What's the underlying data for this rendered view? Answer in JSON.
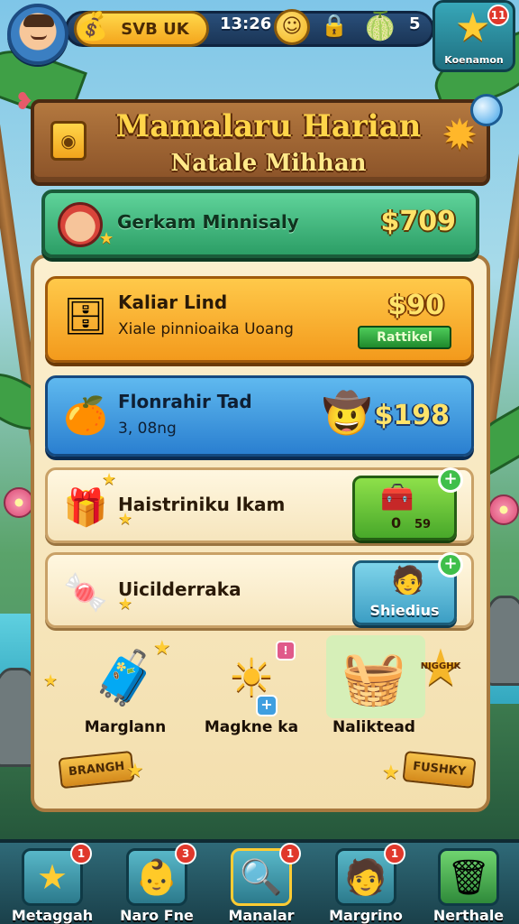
{
  "topbar": {
    "currency_label": "SVB UK",
    "time": "13:26",
    "count": "5",
    "corner_label": "Koenamon",
    "corner_badge": "11"
  },
  "panel": {
    "title": "Mamalaru Harian",
    "subtitle": "Natale Mihhan",
    "featured": {
      "name": "Gerkam Minnisaly",
      "price": "$709"
    },
    "rows": [
      {
        "title": "Kaliar Lind",
        "subtitle": "Xiale pinnioaika Uoang",
        "price": "$90",
        "ribbon": "Rattikel"
      },
      {
        "title": "Flonrahir Tad",
        "subtitle": "3, 08ng",
        "price": "$198"
      },
      {
        "title": "Haistriniku lkam",
        "button_number": "0",
        "button_extra": "59"
      },
      {
        "title": "Uicilderraka",
        "button_label": "Shiedius"
      }
    ],
    "grid": [
      {
        "label": "Marglann"
      },
      {
        "label": "Magkne ka"
      },
      {
        "label": "Naliktead"
      }
    ],
    "stickers": {
      "left": "BRANGH",
      "right": "FUSHKY",
      "star_badge": "NIGGHK"
    }
  },
  "bottom_nav": [
    {
      "label": "Metaggah",
      "badge": "1"
    },
    {
      "label": "Naro Fne",
      "badge": "3"
    },
    {
      "label": "Manalar",
      "badge": "1"
    },
    {
      "label": "Margrino",
      "badge": "1"
    },
    {
      "label": "Nerthale",
      "badge": ""
    }
  ]
}
